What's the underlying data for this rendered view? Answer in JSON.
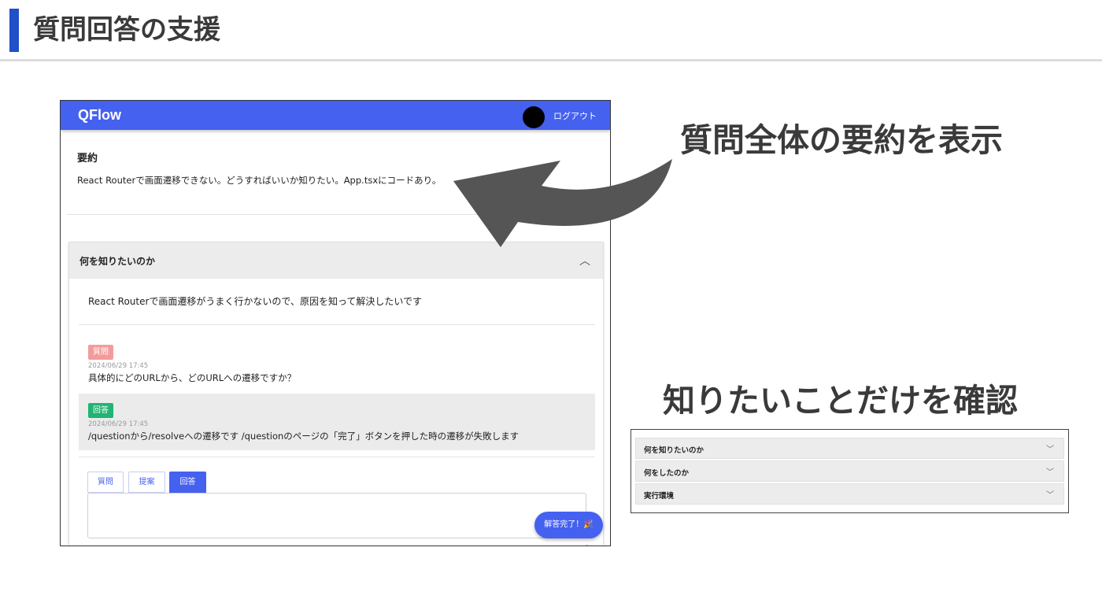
{
  "slide": {
    "title": "質問回答の支援",
    "caption_summary": "質問全体の要約を表示",
    "caption_focus": "知りたいことだけを確認"
  },
  "app": {
    "brand": "QFlow",
    "logout_label": "ログアウト",
    "summary": {
      "title": "要約",
      "text": "React Routerで画面遷移できない。どうすればいいか知りたい。App.tsxにコードあり。"
    },
    "accordion": {
      "title": "何を知りたいのか",
      "expanded_icon": "chevron-up-icon",
      "content": "React Routerで画面遷移がうまく行かないので、原因を知って解決したいです"
    },
    "messages": [
      {
        "badge": "質問",
        "timestamp": "2024/06/29 17:45",
        "text": "具体的にどのURLから、どのURLへの遷移ですか？",
        "badge_color": "#f39b9b"
      },
      {
        "badge": "回答",
        "timestamp": "2024/06/29 17:45",
        "text": "/questionから/resolveへの遷移です /questionのページの「完了」ボタンを押した時の遷移が失敗します",
        "badge_color": "#1fb573"
      }
    ],
    "reply_tabs": [
      {
        "label": "質問",
        "active": false
      },
      {
        "label": "提案",
        "active": false
      },
      {
        "label": "回答",
        "active": true
      }
    ],
    "complete_button": "解答完了！🎉",
    "accent_color": "#4561f0"
  },
  "mini_panel": {
    "items": [
      {
        "label": "何を知りたいのか",
        "icon": "chevron-down-icon"
      },
      {
        "label": "何をしたのか",
        "icon": "chevron-down-icon"
      },
      {
        "label": "実行環境",
        "icon": "chevron-down-icon"
      }
    ]
  }
}
